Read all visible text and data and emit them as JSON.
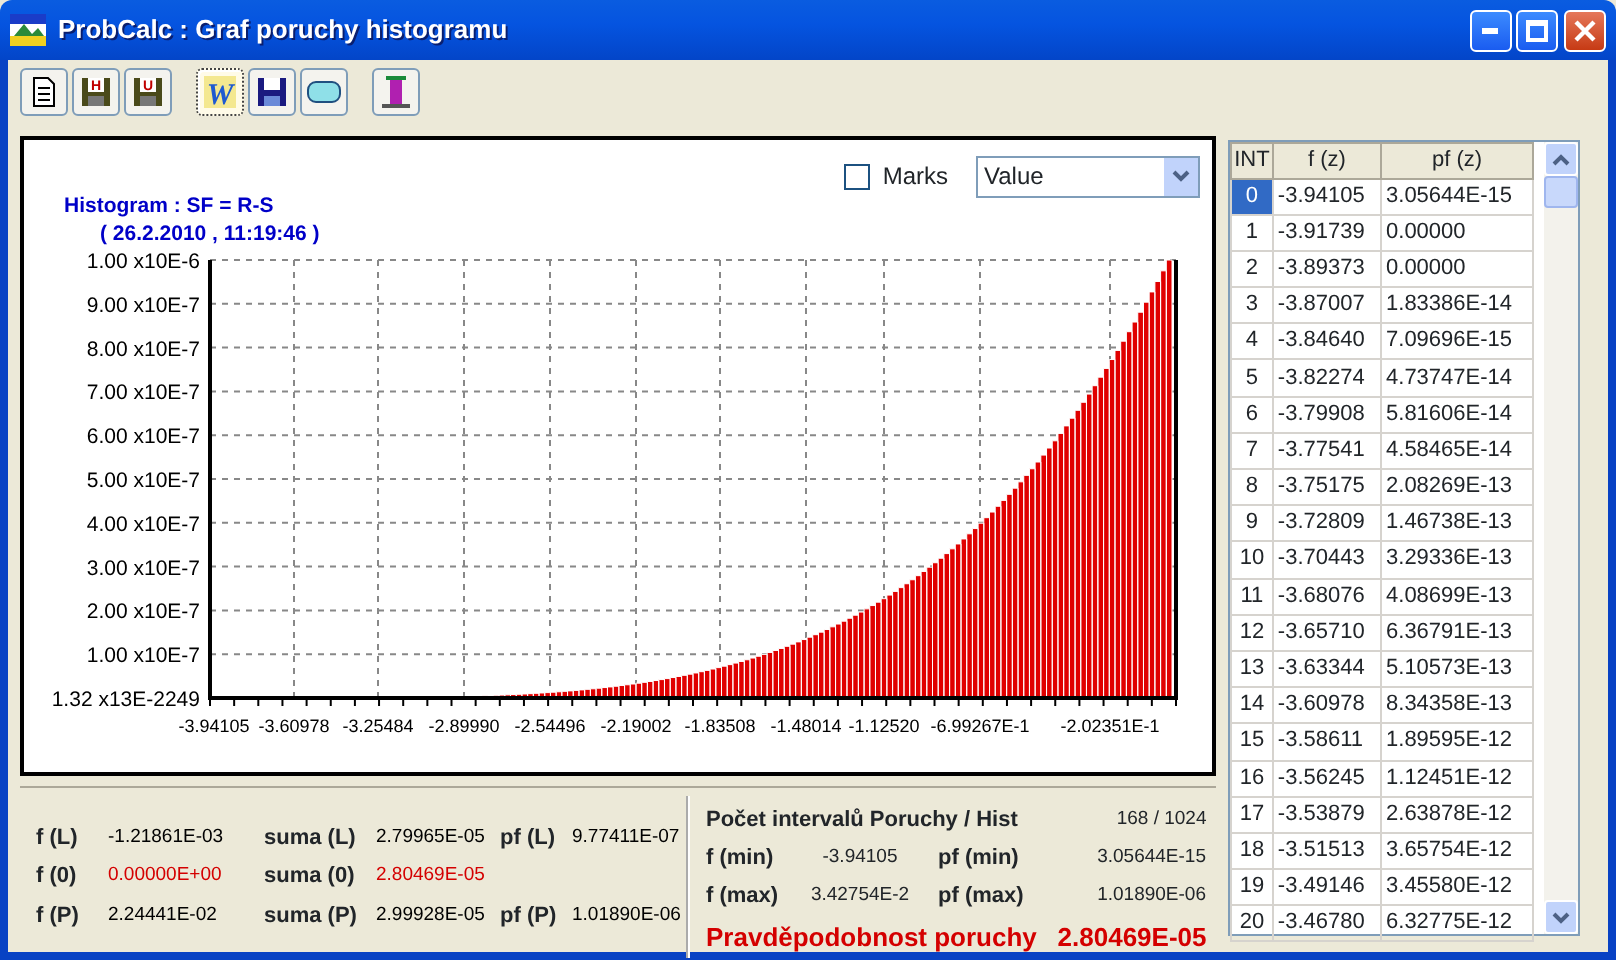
{
  "window": {
    "title": "ProbCalc : Graf poruchy histogramu"
  },
  "toolbar": [
    {
      "kind": "page",
      "pressed": false
    },
    {
      "kind": "disk",
      "label": "H",
      "pressed": false
    },
    {
      "kind": "disk",
      "label": "U",
      "pressed": false
    },
    {
      "kind": "letter",
      "label": "W",
      "pressed": true
    },
    {
      "kind": "disk-blue",
      "pressed": false
    },
    {
      "kind": "rounded",
      "pressed": false
    },
    {
      "kind": "exit",
      "pressed": false
    }
  ],
  "chart": {
    "marks": {
      "label": "Marks",
      "checked": false
    },
    "mode": {
      "value": "Value"
    },
    "title": "Histogram  : SF = R-S",
    "timestamp": "( 26.2.2010 , 11:19:46 )",
    "y_labels": [
      "1.00 x10E-6",
      "9.00 x10E-7",
      "8.00 x10E-7",
      "7.00 x10E-7",
      "6.00 x10E-7",
      "5.00 x10E-7",
      "4.00 x10E-7",
      "3.00 x10E-7",
      "2.00 x10E-7",
      "1.00 x10E-7",
      "1.32 x13E-2249"
    ],
    "x_labels": [
      "-3.94105",
      "-3.60978",
      "-3.25484",
      "-2.89990",
      "-2.54496",
      "-2.19002",
      "-1.83508",
      "-1.48014",
      "-1.12520",
      "-6.99267E-1",
      "-2.02351E-1"
    ]
  },
  "summary": [
    [
      {
        "label": "f (L)",
        "value": "-1.21861E-03",
        "highlighted": false
      },
      {
        "label": "suma (L)",
        "value": "2.79965E-05",
        "highlighted": false
      },
      {
        "label": "pf (L)",
        "value": "9.77411E-07",
        "highlighted": false
      }
    ],
    [
      {
        "label": "f (0)",
        "value": "0.00000E+00",
        "highlighted": true
      },
      {
        "label": "suma (0)",
        "value": "2.80469E-05",
        "highlighted": true
      }
    ],
    [
      {
        "label": "f (P)",
        "value": "2.24441E-02",
        "highlighted": false
      },
      {
        "label": "suma (P)",
        "value": "2.99928E-05",
        "highlighted": false
      },
      {
        "label": "pf (P)",
        "value": "1.01890E-06",
        "highlighted": false
      }
    ]
  ],
  "result": {
    "heading": "Počet intervalů Poruchy / Hist",
    "count": "168 / 1024",
    "rows": [
      [
        {
          "label": "f (min)",
          "value": "-3.94105"
        },
        {
          "label": "pf (min)",
          "value": "3.05644E-15"
        }
      ],
      [
        {
          "label": "f (max)",
          "value": "3.42754E-2"
        },
        {
          "label": "pf (max)",
          "value": "1.01890E-06"
        }
      ]
    ],
    "probability_label": "Pravděpodobnost poruchy",
    "probability_value": "2.80469E-05"
  },
  "table": {
    "columns": [
      "INT",
      "f (z)",
      "pf (z)"
    ],
    "rows": [
      {
        "int": "0",
        "f": "-3.94105",
        "pf": "3.05644E-15",
        "selected": true
      },
      {
        "int": "1",
        "f": "-3.91739",
        "pf": "0.00000",
        "selected": false
      },
      {
        "int": "2",
        "f": "-3.89373",
        "pf": "0.00000",
        "selected": false
      },
      {
        "int": "3",
        "f": "-3.87007",
        "pf": "1.83386E-14",
        "selected": false
      },
      {
        "int": "4",
        "f": "-3.84640",
        "pf": "7.09696E-15",
        "selected": false
      },
      {
        "int": "5",
        "f": "-3.82274",
        "pf": "4.73747E-14",
        "selected": false
      },
      {
        "int": "6",
        "f": "-3.79908",
        "pf": "5.81606E-14",
        "selected": false
      },
      {
        "int": "7",
        "f": "-3.77541",
        "pf": "4.58465E-14",
        "selected": false
      },
      {
        "int": "8",
        "f": "-3.75175",
        "pf": "2.08269E-13",
        "selected": false
      },
      {
        "int": "9",
        "f": "-3.72809",
        "pf": "1.46738E-13",
        "selected": false
      },
      {
        "int": "10",
        "f": "-3.70443",
        "pf": "3.29336E-13",
        "selected": false
      },
      {
        "int": "11",
        "f": "-3.68076",
        "pf": "4.08699E-13",
        "selected": false
      },
      {
        "int": "12",
        "f": "-3.65710",
        "pf": "6.36791E-13",
        "selected": false
      },
      {
        "int": "13",
        "f": "-3.63344",
        "pf": "5.10573E-13",
        "selected": false
      },
      {
        "int": "14",
        "f": "-3.60978",
        "pf": "8.34358E-13",
        "selected": false
      },
      {
        "int": "15",
        "f": "-3.58611",
        "pf": "1.89595E-12",
        "selected": false
      },
      {
        "int": "16",
        "f": "-3.56245",
        "pf": "1.12451E-12",
        "selected": false
      },
      {
        "int": "17",
        "f": "-3.53879",
        "pf": "2.63878E-12",
        "selected": false
      },
      {
        "int": "18",
        "f": "-3.51513",
        "pf": "3.65754E-12",
        "selected": false
      },
      {
        "int": "19",
        "f": "-3.49146",
        "pf": "3.45580E-12",
        "selected": false
      },
      {
        "int": "20",
        "f": "-3.46780",
        "pf": "6.32775E-12",
        "selected": false
      }
    ]
  }
}
